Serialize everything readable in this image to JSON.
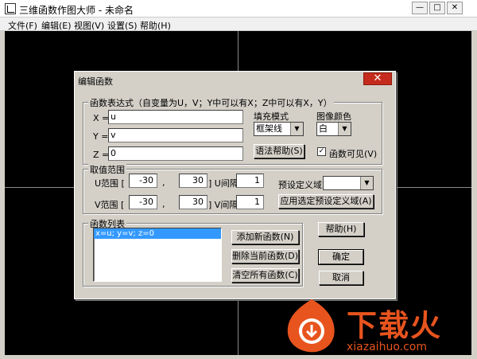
{
  "window": {
    "title": "三维函数作图大师 - 未命名",
    "minimize": "—",
    "maximize": "□",
    "close": "✕"
  },
  "menu": [
    "文件(F)",
    "编辑(E)",
    "视图(V)",
    "设置(S)",
    "帮助(H)"
  ],
  "dialog": {
    "title": "编辑函数",
    "close": "✕",
    "expr_group": "函数表达式（自变量为U，V；Y中可以有X；Z中可以有X，Y）",
    "x_label": "X =",
    "x_value": "u",
    "y_label": "Y =",
    "y_value": "v",
    "z_label": "Z =",
    "z_value": "0",
    "fill_mode_label": "填充模式",
    "fill_mode_value": "框架线",
    "image_color_label": "图像颜色",
    "image_color_value": "白",
    "syntax_help": "语法帮助(S)",
    "visible_label": "函数可见(V)",
    "visible_check": "✓",
    "range_group": "取值范围",
    "u_range_label": "U范围 [",
    "u_min": "-30",
    "u_comma": ",",
    "u_max": "30",
    "u_interval_label": "] U间隔",
    "u_interval": "1",
    "v_range_label": "V范围 [",
    "v_min": "-30",
    "v_comma": ",",
    "v_max": "30",
    "v_interval_label": "] V间隔",
    "v_interval": "1",
    "preset_label": "预设定义域:",
    "preset_value": "",
    "apply_preset": "应用选定预设定义域(A)",
    "list_group": "函数列表",
    "functions": [
      "x=u; y=v; z=0"
    ],
    "add_func": "添加新函数(N)",
    "delete_func": "删除当前函数(D)",
    "clear_funcs": "清空所有函数(C)",
    "help": "帮助(H)",
    "ok": "确定",
    "cancel": "取消"
  },
  "watermark": {
    "text": "下载火",
    "url": "xiazaihuo.com"
  },
  "colors": {
    "canvas": "#000000",
    "selection": "#3399ff",
    "close_red": "#c42b1c",
    "watermark": "#e8541e"
  }
}
